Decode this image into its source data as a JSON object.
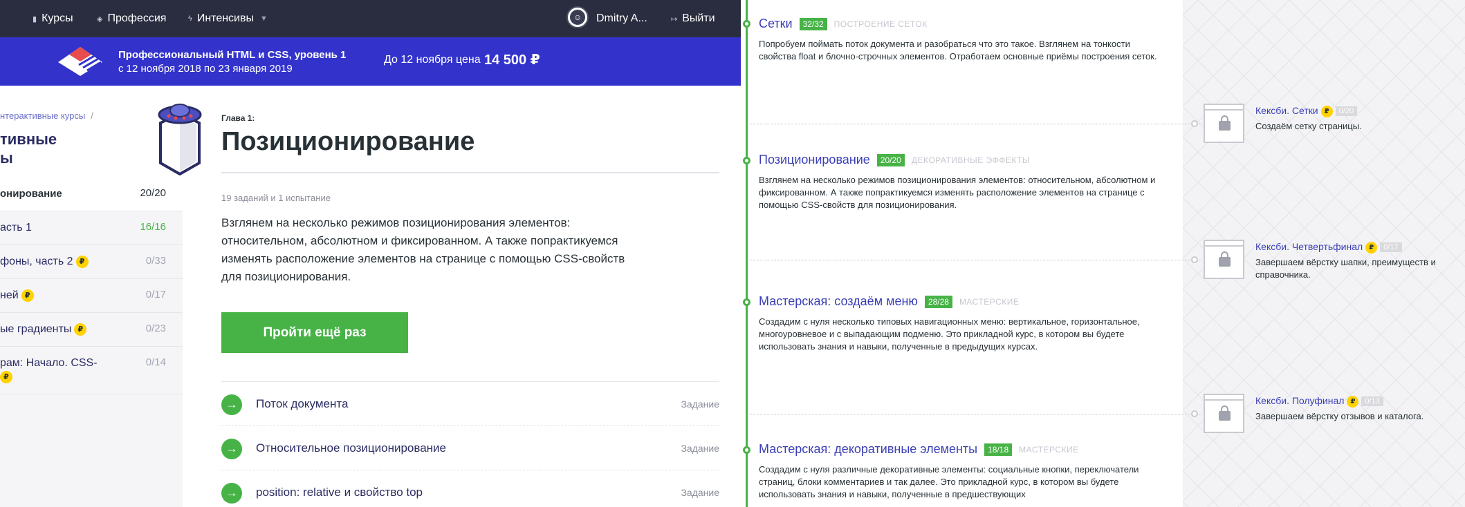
{
  "nav": {
    "courses": "Курсы",
    "profession": "Профессия",
    "intensives": "Интенсивы",
    "user_name": "Dmitry A...",
    "logout": "Выйти"
  },
  "promo": {
    "title": "Профессиональный HTML и CSS, уровень 1",
    "dates": "с 12 ноября 2018 по 23 января 2019",
    "price_label": "До 12 ноября цена",
    "price": "14 500 ₽"
  },
  "sidebar": {
    "breadcrumb": "нтерактивные курсы",
    "breadcrumb_sep": "/",
    "title_line1": "тивные",
    "title_line2": "ы",
    "items": [
      {
        "label": "онирование",
        "count": "20/20"
      },
      {
        "label": "асть 1",
        "count": "16/16"
      },
      {
        "label": "фоны, часть 2",
        "count": "0/33"
      },
      {
        "label": "ней",
        "count": "0/17"
      },
      {
        "label": "ые градиенты",
        "count": "0/23"
      },
      {
        "label_line1": "рам: Начало. CSS-",
        "label_line2": "",
        "count": "0/14"
      }
    ]
  },
  "coin_symbol": "₽",
  "main": {
    "chapter_label": "Глава 1:",
    "chapter_title": "Позиционирование",
    "task_count": "19 заданий и 1 испытание",
    "description": "Взглянем на несколько режимов позиционирования элементов: относительном, абсолютном и фиксированном. А также попрактикуемся изменять расположение элементов на странице с помощью CSS-свойств для позиционирования.",
    "retry_button": "Пройти ещё раз",
    "tasks": [
      {
        "name": "Поток документа",
        "type": "Задание"
      },
      {
        "name": "Относительное позиционирование",
        "type": "Задание"
      },
      {
        "name": "position: relative и свойство top",
        "type": "Задание"
      }
    ]
  },
  "timeline": {
    "courses": [
      {
        "title": "Сетки",
        "badge": "32/32",
        "category": "ПОСТРОЕНИЕ СЕТОК",
        "description": "Попробуем поймать поток документа и разобраться что это такое. Взглянем на тонкости свойства float и блочно-строчных элементов. Отработаем основные приёмы построения сеток."
      },
      {
        "title": "Позиционирование",
        "badge": "20/20",
        "category": "ДЕКОРАТИВНЫЕ ЭФФЕКТЫ",
        "description": "Взглянем на несколько режимов позиционирования элементов: относительном, абсолютном и фиксированном. А также попрактикуемся изменять расположение элементов на странице с помощью CSS-свойств для позиционирования."
      },
      {
        "title": "Мастерская: создаём меню",
        "badge": "28/28",
        "category": "МАСТЕРСКИЕ",
        "description": "Создадим с нуля несколько типовых навигационных меню: вертикальное, горизонтальное, многоуровневое и с выпадающим подменю. Это прикладной курс, в котором вы будете использовать знания и навыки, полученные в предыдущих курсах."
      },
      {
        "title": "Мастерская: декоративные элементы",
        "badge": "18/18",
        "category": "МАСТЕРСКИЕ",
        "description": "Создадим с нуля различные декоративные элементы: социальные кнопки, переключатели страниц, блоки комментариев и так далее. Это прикладной курс, в котором вы будете использовать знания и навыки, полученные в предшествующих"
      }
    ],
    "kexbi": [
      {
        "title": "Кексби. Сетки",
        "badge": "0/20",
        "description": "Создаём сетку страницы."
      },
      {
        "title": "Кексби. Четвертьфинал",
        "badge": "0/17",
        "description": "Завершаем вёрстку шапки, преимуществ и справочника."
      },
      {
        "title": "Кексби. Полуфинал",
        "badge": "0/13",
        "description": "Завершаем вёрстку отзывов и каталога."
      }
    ]
  },
  "colors": {
    "nav_bg": "#2a2d3f",
    "promo_bg": "#3333cc",
    "accent_green": "#47b347",
    "link_blue": "#3b3fb6",
    "coin_yellow": "#ffd200"
  }
}
